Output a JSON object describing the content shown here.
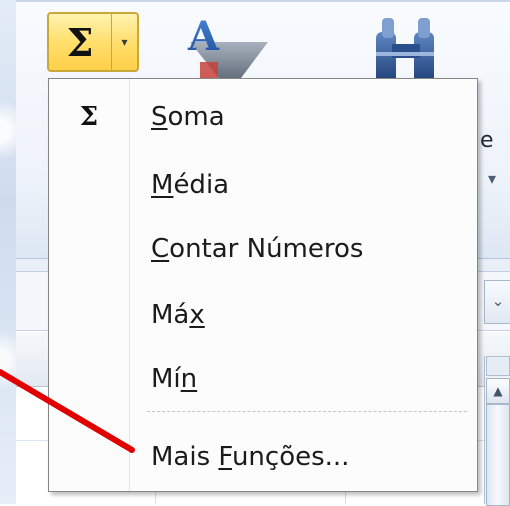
{
  "ribbon": {
    "autosum_symbol": "Σ",
    "autosum_arrow": "▾",
    "cut_label_fragment": "e",
    "ribbon_dropdown_arrow": "▾"
  },
  "menu": {
    "items": [
      {
        "icon": "Σ",
        "pre": "",
        "accel": "S",
        "post": "oma"
      },
      {
        "icon": "",
        "pre": "",
        "accel": "M",
        "post": "édia"
      },
      {
        "icon": "",
        "pre": "",
        "accel": "C",
        "post": "ontar Números"
      },
      {
        "icon": "",
        "pre": "Má",
        "accel": "x",
        "post": ""
      },
      {
        "icon": "",
        "pre": "Mí",
        "accel": "n",
        "post": ""
      },
      {
        "icon": "",
        "pre": "Mais ",
        "accel": "F",
        "post": "unções..."
      }
    ]
  },
  "sheet": {
    "combo_arrow": "⌄",
    "scroll_up": "▲"
  },
  "colors": {
    "autosum_highlight": "#ffd04a",
    "annotation_arrow": "#e00000"
  }
}
